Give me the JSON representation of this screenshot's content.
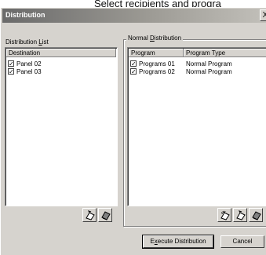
{
  "background_caption": "Select recipients and progra",
  "window": {
    "title": "Distribution",
    "close_symbol": "X"
  },
  "distribution_list": {
    "label_prefix": "Distribution ",
    "label_accel": "L",
    "label_suffix": "ist",
    "column": "Destination",
    "items": [
      {
        "name": "Panel 02",
        "checked": true
      },
      {
        "name": "Panel 03",
        "checked": true
      }
    ]
  },
  "normal_distribution": {
    "legend_prefix": "Normal ",
    "legend_accel": "D",
    "legend_suffix": "istribution",
    "columns": [
      "Program",
      "Program Type"
    ],
    "rows": [
      {
        "program": "Programs 01",
        "type": "Normal Program",
        "checked": true
      },
      {
        "program": "Programs 02",
        "type": "Normal Program",
        "checked": true
      }
    ]
  },
  "buttons": {
    "execute_prefix": "E",
    "execute_accel": "x",
    "execute_suffix": "ecute Distribution",
    "cancel": "Cancel"
  },
  "icons": {
    "left_icons": [
      "edit-icon",
      "delete-icon"
    ],
    "right_icons": [
      "add-icon",
      "edit-icon",
      "delete-icon"
    ]
  },
  "colors": {
    "window_face": "#d6d3ce",
    "title_dark": "#6a6a6a",
    "title_light": "#c2c0ba"
  }
}
